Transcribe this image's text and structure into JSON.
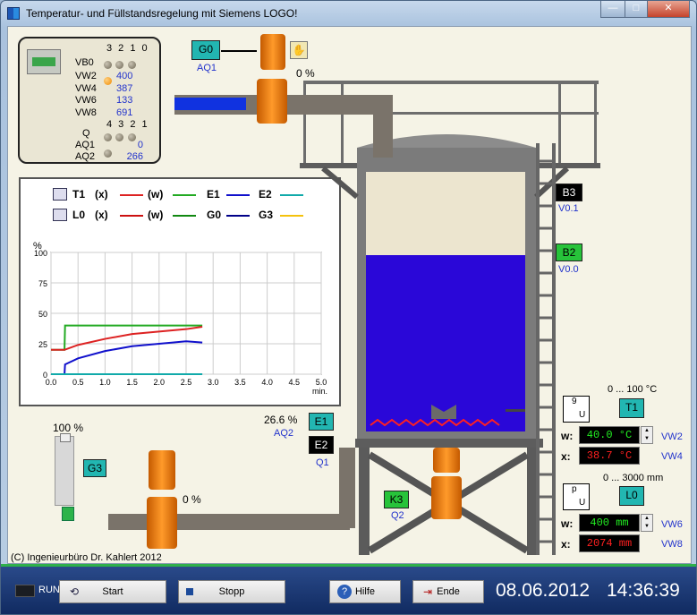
{
  "window": {
    "title": "Temperatur- und Füllstandsregelung mit Siemens LOGO!",
    "min": "—",
    "max": "□",
    "close": "✕"
  },
  "logo_panel": {
    "vb_header": "3 2 1 0",
    "vb0": "VB0",
    "vars": [
      {
        "name": "VW2",
        "value": "400"
      },
      {
        "name": "VW4",
        "value": "387"
      },
      {
        "name": "VW6",
        "value": "133"
      },
      {
        "name": "VW8",
        "value": "691"
      }
    ],
    "q_header": "4 3 2 1",
    "q": "Q",
    "aq": [
      {
        "name": "AQ1",
        "value": "0"
      },
      {
        "name": "AQ2",
        "value": "266"
      }
    ]
  },
  "chart_legend": {
    "row1": {
      "first": "T1",
      "x": "(x)",
      "w": "(w)",
      "e1": "E1",
      "e2": "E2"
    },
    "row2": {
      "first": "L0",
      "x": "(x)",
      "w": "(w)",
      "g0": "G0",
      "g3": "G3"
    }
  },
  "chart_data": {
    "type": "line",
    "ylabel": "%",
    "xlabel": "min.",
    "xlim": [
      0,
      5
    ],
    "ylim": [
      0,
      100
    ],
    "x_ticks": [
      "0.0",
      "0.5",
      "1.0",
      "1.5",
      "2.0",
      "2.5",
      "3.0",
      "3.5",
      "4.0",
      "4.5",
      "5.0"
    ],
    "y_ticks": [
      "0",
      "25",
      "50",
      "75",
      "100"
    ],
    "grid": true,
    "series": [
      {
        "color": "#22aa22",
        "x": [
          0,
          0.25,
          0.26,
          2.8
        ],
        "y": [
          20,
          20,
          40,
          40
        ]
      },
      {
        "color": "#dd2222",
        "x": [
          0,
          0.25,
          0.5,
          1.0,
          1.5,
          2.0,
          2.5,
          2.8
        ],
        "y": [
          20,
          20,
          24,
          29,
          33,
          35,
          37,
          39
        ]
      },
      {
        "color": "#1010cc",
        "x": [
          0.25,
          0.26,
          0.5,
          1.0,
          1.5,
          2.0,
          2.5,
          2.8
        ],
        "y": [
          0,
          8,
          13,
          19,
          23,
          25,
          27,
          26
        ]
      },
      {
        "color": "#11aaaa",
        "x": [
          0,
          2.8
        ],
        "y": [
          0,
          0
        ]
      }
    ]
  },
  "controls": {
    "g0": "G0",
    "aq1": "AQ1",
    "pump_top_pct": "0 %",
    "g3": "G3",
    "slider_pct": "100 %",
    "pump_bottom_pct": "0 %",
    "e1": "E1",
    "e2": "E2",
    "e_pct": "26.6 %",
    "aq2": "AQ2",
    "q1": "Q1",
    "k3": "K3",
    "q2": "Q2",
    "b3": "B3",
    "v01": "V0.1",
    "b2": "B2",
    "v00": "V0.0"
  },
  "temp": {
    "range": "0 ... 100 °C",
    "conv_top": "9",
    "conv_bot": "U",
    "tag": "T1",
    "w_label": "w:",
    "w_value": "40.0 °C",
    "w_var": "VW2",
    "x_label": "x:",
    "x_value": "38.7 °C",
    "x_var": "VW4"
  },
  "level": {
    "range": "0 ... 3000 mm",
    "conv_top": "p",
    "conv_bot": "U",
    "tag": "L0",
    "w_label": "w:",
    "w_value": "400 mm",
    "w_var": "VW6",
    "x_label": "x:",
    "x_value": "2074 mm",
    "x_var": "VW8"
  },
  "copyright": "(C) Ingenieurbüro Dr. Kahlert 2012",
  "statusbar": {
    "run": "RUN",
    "start": "Start",
    "stop": "Stopp",
    "help": "Hilfe",
    "end": "Ende",
    "date": "08.06.2012",
    "time": "14:36:39"
  }
}
